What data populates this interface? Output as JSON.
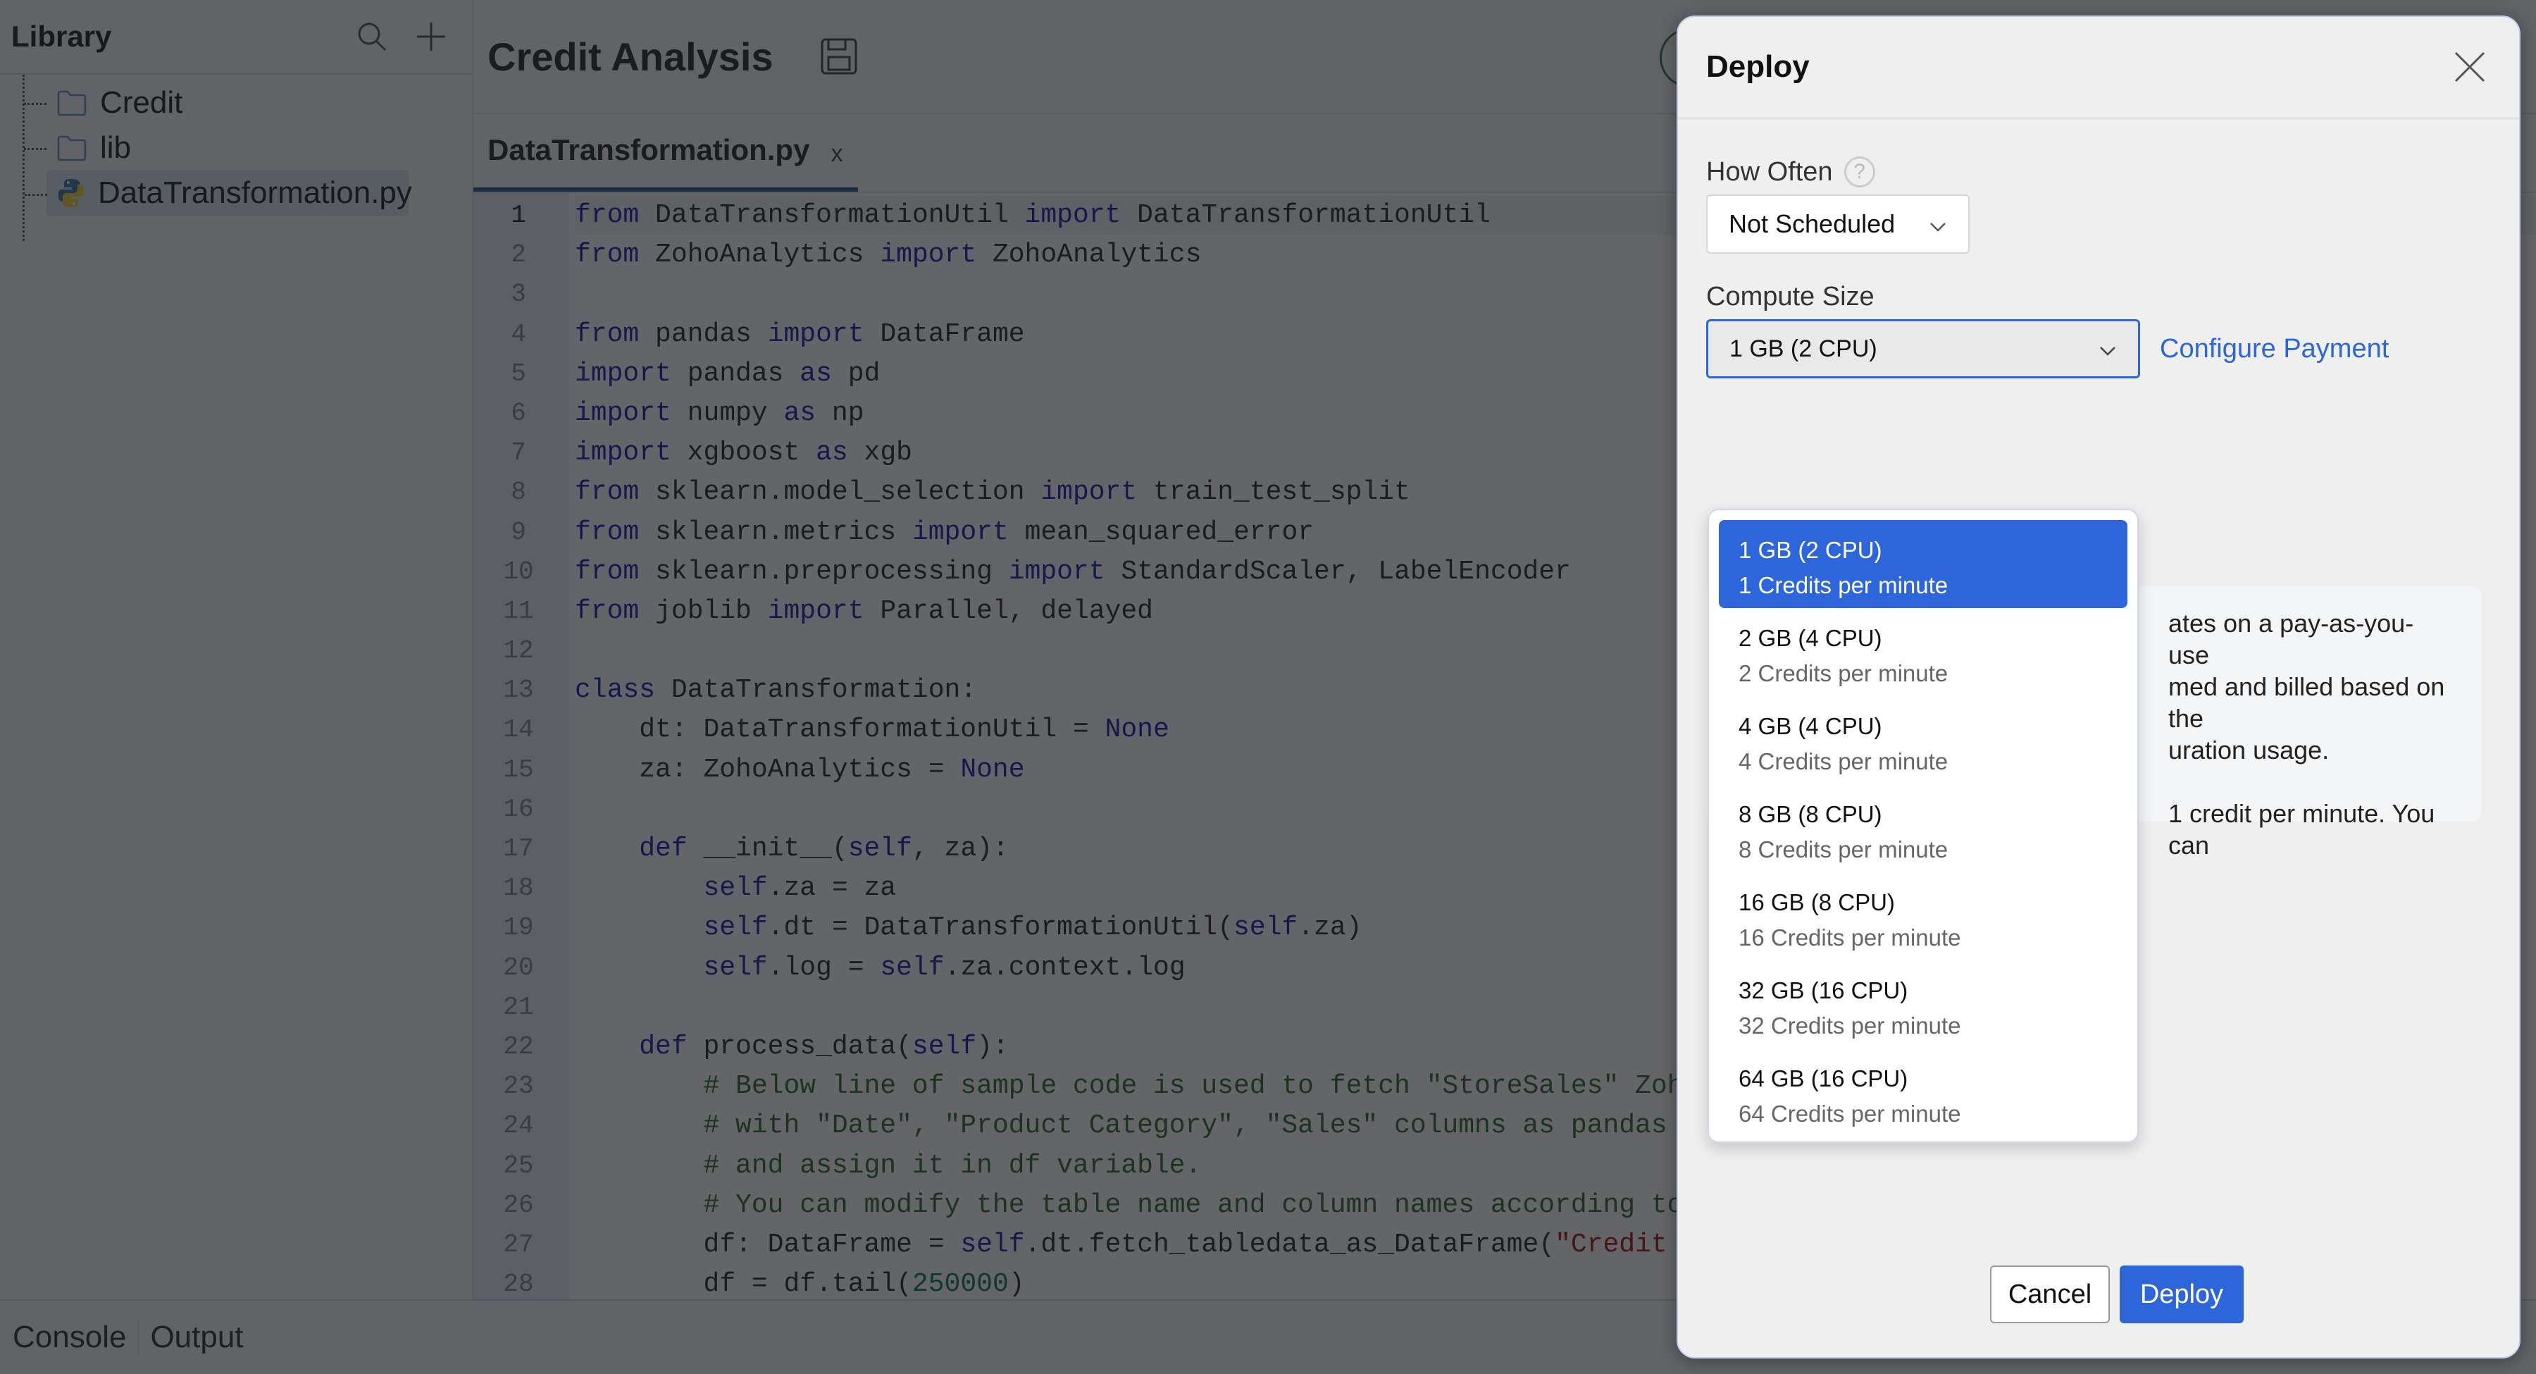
{
  "sidebar": {
    "title": "Library",
    "search_icon": "search-icon",
    "add_icon": "plus-icon",
    "tree": [
      {
        "label": "Credit",
        "icon": "folder-icon"
      },
      {
        "label": "lib",
        "icon": "folder-icon"
      },
      {
        "label": "DataTransformation.py",
        "icon": "python-file-icon",
        "selected": true
      }
    ]
  },
  "editor": {
    "project_title": "Credit Analysis",
    "save_icon": "save-icon",
    "tabs": [
      {
        "label": "DataTransformation.py",
        "close_label": "x",
        "active": true
      }
    ],
    "line_numbers": [
      "1",
      "2",
      "3",
      "4",
      "5",
      "6",
      "7",
      "8",
      "9",
      "10",
      "11",
      "12",
      "13",
      "14",
      "15",
      "16",
      "17",
      "18",
      "19",
      "20",
      "21",
      "22",
      "23",
      "24",
      "25",
      "26",
      "27",
      "28"
    ],
    "code_lines": [
      "from DataTransformationUtil import DataTransformationUtil",
      "from ZohoAnalytics import ZohoAnalytics",
      "",
      "from pandas import DataFrame",
      "import pandas as pd",
      "import numpy as np",
      "import xgboost as xgb",
      "from sklearn.model_selection import train_test_split",
      "from sklearn.metrics import mean_squared_error",
      "from sklearn.preprocessing import StandardScaler, LabelEncoder",
      "from joblib import Parallel, delayed",
      "",
      "class DataTransformation:",
      "    dt: DataTransformationUtil = None",
      "    za: ZohoAnalytics = None",
      "",
      "    def __init__(self, za):",
      "        self.za = za",
      "        self.dt = DataTransformationUtil(self.za)",
      "        self.log = self.za.context.log",
      "",
      "    def process_data(self):",
      "        # Below line of sample code is used to fetch \"StoreSales\" Zoho",
      "        # with \"Date\", \"Product Category\", \"Sales\" columns as pandas D",
      "        # and assign it in df variable.",
      "        # You can modify the table name and column names according to",
      "        df: DataFrame = self.dt.fetch_tabledata_as_DataFrame(\"Credit D",
      "        df = df.tail(250000)"
    ]
  },
  "bottom_tabs": [
    {
      "label": "Console",
      "active": true
    },
    {
      "label": "Output",
      "active": false
    }
  ],
  "modal": {
    "title": "Deploy",
    "close_icon": "close-icon",
    "how_often": {
      "label": "How Often",
      "help_icon": "?",
      "value": "Not Scheduled"
    },
    "compute_size": {
      "label": "Compute Size",
      "value": "1 GB (2 CPU)",
      "configure_link": "Configure Payment",
      "options": [
        {
          "title": "1 GB (2 CPU)",
          "subtitle": "1 Credits per minute",
          "selected": true
        },
        {
          "title": "2 GB (4 CPU)",
          "subtitle": "2 Credits per minute"
        },
        {
          "title": "4 GB (4 CPU)",
          "subtitle": "4 Credits per minute"
        },
        {
          "title": "8 GB (8 CPU)",
          "subtitle": "8 Credits per minute"
        },
        {
          "title": "16 GB (8 CPU)",
          "subtitle": "16 Credits per minute"
        },
        {
          "title": "32 GB (16 CPU)",
          "subtitle": "32 Credits per minute"
        },
        {
          "title": "64 GB (16 CPU)",
          "subtitle": "64 Credits per minute"
        }
      ]
    },
    "info_visible_text": {
      "line1": "ates on a pay-as-you-use",
      "line2": "med and billed based on the",
      "line3": "uration usage.",
      "line4": "1 credit per minute. You can"
    },
    "buttons": {
      "cancel": "Cancel",
      "deploy": "Deploy"
    }
  },
  "colors": {
    "accent": "#2d66db",
    "keyword": "#1d1eac",
    "comment": "#2f6b2f",
    "string": "#a31515"
  }
}
